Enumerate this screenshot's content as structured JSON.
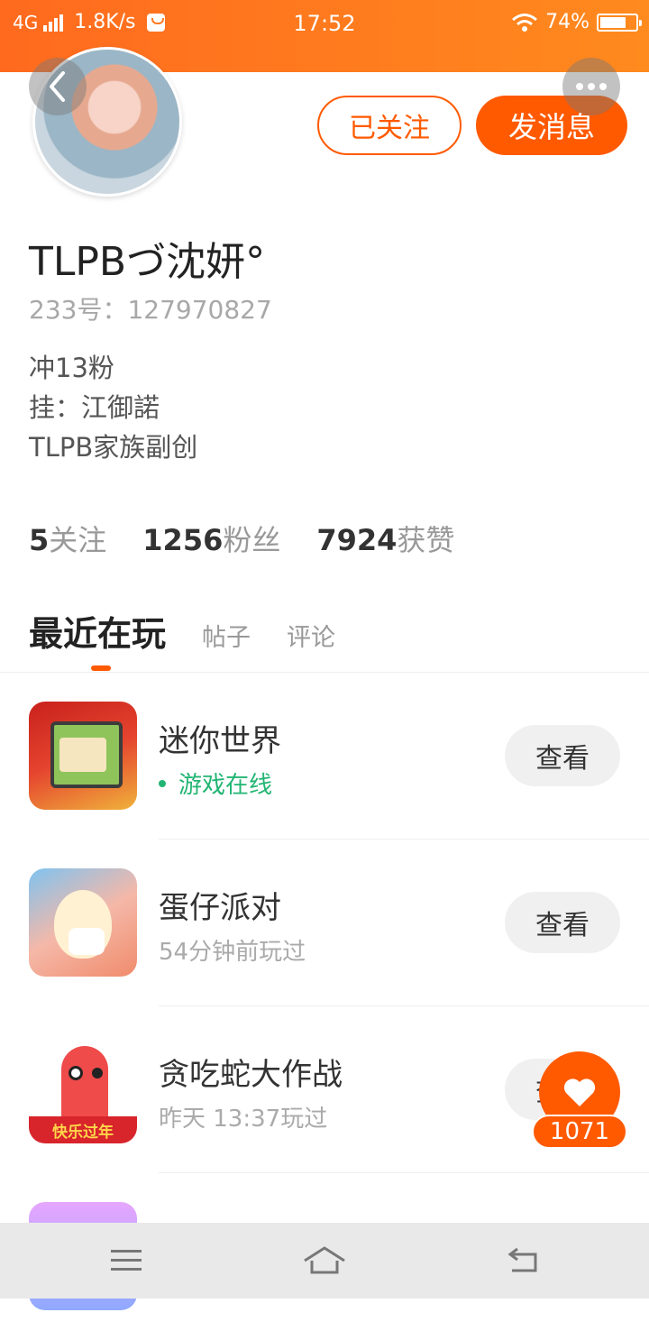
{
  "status_bar": {
    "network": "4G",
    "speed": "1.8K/s",
    "time": "17:52",
    "battery": "74%",
    "battery_level": 0.74,
    "icons": [
      "signal-icon",
      "shopping-bag-icon",
      "wifi-icon",
      "battery-icon"
    ]
  },
  "header": {
    "back_icon": "chevron-left-icon",
    "more_icon": "more-dots-icon"
  },
  "profile": {
    "followed_label": "已关注",
    "message_label": "发消息",
    "nickname": "TLPBづ沈妍°",
    "user_id": "233号：127970827",
    "bio": [
      "冲13粉",
      "挂：江御諾",
      "TLPB家族副创"
    ],
    "stats": [
      {
        "value": "5",
        "label": "关注"
      },
      {
        "value": "1256",
        "label": "粉丝"
      },
      {
        "value": "7924",
        "label": "获赞"
      }
    ]
  },
  "tabs": [
    {
      "label": "最近在玩",
      "active": true
    },
    {
      "label": "帖子",
      "active": false
    },
    {
      "label": "评论",
      "active": false
    }
  ],
  "games": [
    {
      "name": "迷你世界",
      "status": "游戏在线",
      "online": true,
      "action": "查看"
    },
    {
      "name": "蛋仔派对",
      "status": "54分钟前玩过",
      "online": false,
      "action": "查看"
    },
    {
      "name": "贪吃蛇大作战",
      "status": "昨天 13:37玩过",
      "online": false,
      "action": "查看",
      "icon_banner": "快乐过年"
    }
  ],
  "like": {
    "count": "1071",
    "icon": "heart-icon"
  },
  "nav_bar": {
    "icons": [
      "menu-icon",
      "home-icon",
      "back-icon"
    ]
  },
  "colors": {
    "accent": "#ff5a00",
    "online": "#22b573",
    "status_bar": "#ff7a1e"
  }
}
